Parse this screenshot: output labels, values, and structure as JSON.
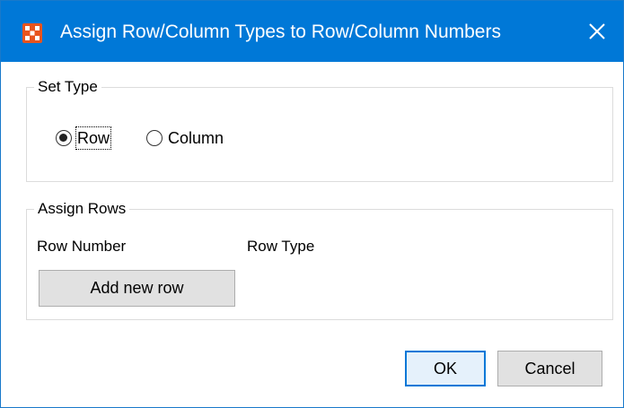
{
  "window": {
    "title": "Assign Row/Column Types to Row/Column Numbers",
    "icon": "app-grid-icon",
    "close_icon": "close-icon",
    "titlebar_color": "#0078d7",
    "icon_color": "#e8541e"
  },
  "set_type": {
    "legend": "Set Type",
    "options": [
      {
        "label": "Row",
        "checked": true
      },
      {
        "label": "Column",
        "checked": false
      }
    ]
  },
  "assign_rows": {
    "legend": "Assign Rows",
    "columns": [
      "Row Number",
      "Row Type"
    ],
    "add_button_label": "Add new row"
  },
  "footer": {
    "ok_label": "OK",
    "cancel_label": "Cancel"
  }
}
